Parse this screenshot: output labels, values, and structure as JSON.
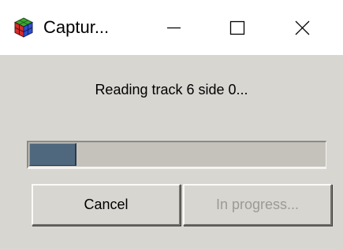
{
  "window": {
    "title": "Captur...",
    "controls": {
      "minimize": "minimize-icon",
      "maximize": "maximize-icon",
      "close": "close-icon"
    }
  },
  "status": {
    "message": "Reading track 6 side 0..."
  },
  "progress": {
    "fraction": 0.16
  },
  "buttons": {
    "cancel_label": "Cancel",
    "in_progress_label": "In progress..."
  },
  "colors": {
    "titlebar": "#ffffff",
    "dialog_bg": "#d8d6d1",
    "progress_fill": "#50687e",
    "progress_track": "#c5c2bc",
    "disabled_text": "#9c9a96"
  }
}
